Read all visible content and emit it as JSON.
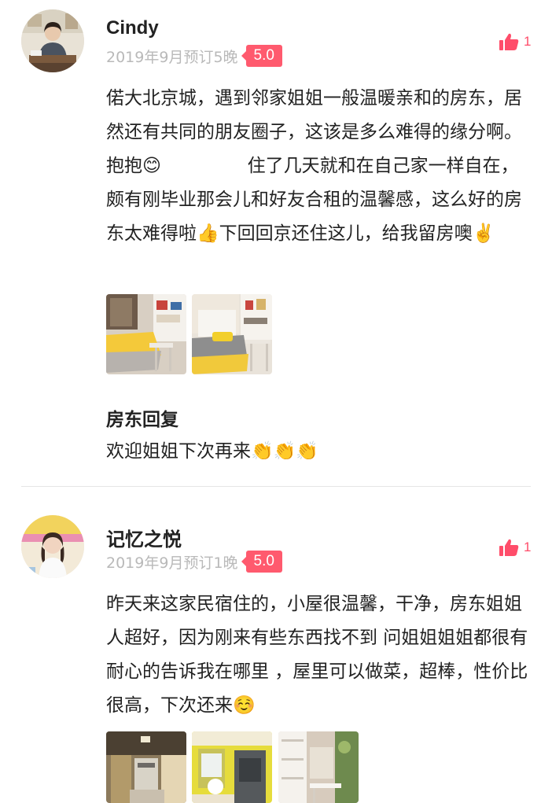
{
  "reviews": [
    {
      "author": "Cindy",
      "meta": "2019年9月预订5晚",
      "rating": "5.0",
      "likes": "1",
      "text": "偌大北京城，遇到邻家姐姐一般温暖亲和的房东，居然还有共同的朋友圈子，这该是多么难得的缘分啊。抱抱😊               住了几天就和在自己家一样自在，颇有刚毕业那会儿和好友合租的温馨感，这么好的房东太难得啦👍下回回京还住这儿，给我留房噢✌️",
      "photos": [
        "bedroom-yellow-quilt-photo",
        "bedroom-desk-photo"
      ],
      "host_reply": {
        "title": "房东回复",
        "text": "欢迎姐姐下次再来👏👏👏"
      }
    },
    {
      "author": "记忆之悦",
      "meta": "2019年9月预订1晚",
      "rating": "5.0",
      "likes": "1",
      "text": "昨天来这家民宿住的，小屋很温馨，干净，房东姐姐人超好，因为刚来有些东西找不到 问姐姐姐姐都很有耐心的告诉我在哪里 ，屋里可以做菜，超棒，性价比很高，下次还来☺️",
      "photos": [
        "kitchen-photo",
        "bathroom-yellow-photo",
        "living-room-shelf-photo"
      ]
    }
  ],
  "colors": {
    "accent": "#ff5a6e",
    "like": "#ff4d6a",
    "meta_text": "#b9b9b9",
    "divider": "#e5e5e5"
  },
  "icons": {
    "like": "thumbs-up-icon"
  }
}
